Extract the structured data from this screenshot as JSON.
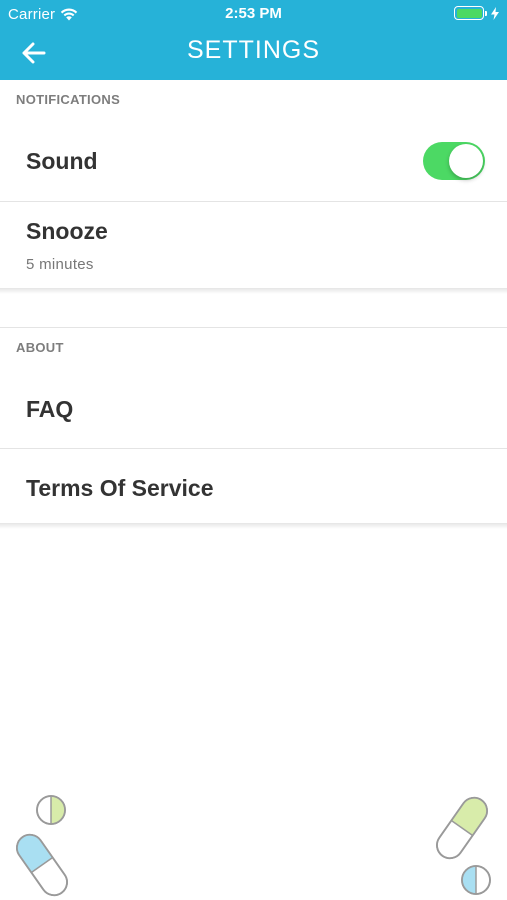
{
  "status_bar": {
    "carrier": "Carrier",
    "time": "2:53 PM",
    "battery_level": 1.0,
    "wifi_icon": "wifi-icon",
    "charging_icon": "bolt-icon"
  },
  "nav": {
    "title": "SETTINGS",
    "back_icon": "arrow-left-icon"
  },
  "sections": {
    "notifications": {
      "header": "NOTIFICATIONS",
      "sound": {
        "label": "Sound",
        "enabled": true
      },
      "snooze": {
        "label": "Snooze",
        "value": "5 minutes"
      }
    },
    "about": {
      "header": "ABOUT",
      "faq": {
        "label": "FAQ"
      },
      "terms": {
        "label": "Terms Of Service"
      }
    }
  },
  "colors": {
    "header_bg": "#26b2d8",
    "toggle_on": "#4cd964",
    "pill_blue": "#a9dff2",
    "pill_green": "#d8ecaa"
  },
  "decorations": [
    "pill-capsule-icon",
    "pill-tablet-icon"
  ]
}
